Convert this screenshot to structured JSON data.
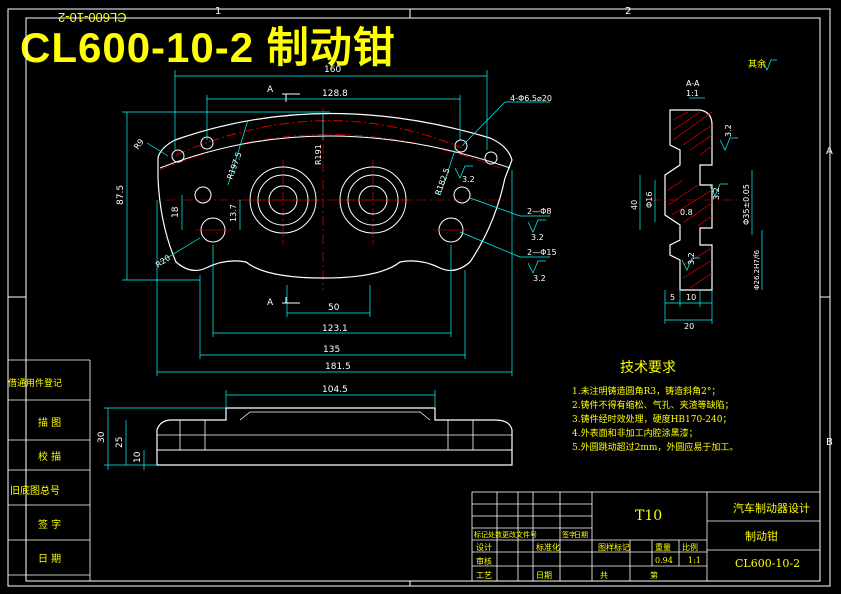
{
  "drawing": {
    "title": "CL600-10-2 制动钳",
    "mirrored_code": "CL600-10-2",
    "grid": {
      "top": [
        "1",
        "2"
      ],
      "side": [
        "A",
        "B"
      ]
    },
    "roughness_note": "其余",
    "dimensions": {
      "d160": "160",
      "d128_8": "128.8",
      "d4_hole": "4-Φ6.5⌀20",
      "r191": "R191",
      "r197_5": "R197.5",
      "r182_5": "R182.5",
      "d87_5": "87.5",
      "d18": "18",
      "d13_7": "13.7",
      "r20": "R20",
      "d9": "R9",
      "h2_8": "2—Φ8",
      "h2_15": "2—Φ15",
      "r3_2": "3.2",
      "d50": "50",
      "d123_1": "123.1",
      "d135": "135",
      "d181_5": "181.5",
      "d104_5": "104.5",
      "d30": "30",
      "d25": "25",
      "d10": "10",
      "section_a": "A",
      "section_view": "A-A",
      "section_scale": "1:1",
      "d40": "40",
      "d16": "Φ16",
      "d0_8": "0.8",
      "d35": "Φ35±0.05",
      "d26": "Φ26.2H7/f6",
      "d5": "5",
      "d10b": "10",
      "d20": "20"
    },
    "tech_requirements": {
      "title": "技术要求",
      "items": [
        "1.未注明铸造圆角R3，铸造斜角2°；",
        "2.铸件不得有缩松、气孔、夹渣等缺陷；",
        "3.铸件经时效处理，硬度HB170-240；",
        "4.外表面和非加工内腔涂黑漆；",
        "5.外圆跳动超过2mm，外圆应易于加工。"
      ]
    },
    "side_labels": [
      "借通用件登记",
      "描 图",
      "校 描",
      "旧底图总号",
      "签 字",
      "日 期"
    ],
    "title_block": {
      "material": "T10",
      "design_name": "汽车制动器设计",
      "part_name": "制动钳",
      "part_code": "CL600-10-2",
      "stage_label": "图样标记",
      "weight_label": "重量",
      "scale_label": "比例",
      "weight": "0.94",
      "scale": "1:1",
      "sheets_total": "共",
      "sheet_no": "第",
      "row_labels": [
        "标记处数更改文件号",
        "签字",
        "日期"
      ],
      "designer_label": "设计",
      "checker_label": "审核",
      "process_label": "工艺",
      "date_label": "日期",
      "standard_label": "标准化"
    }
  }
}
